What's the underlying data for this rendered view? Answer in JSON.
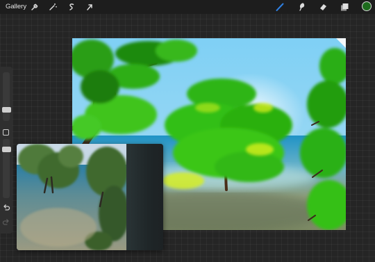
{
  "toolbar": {
    "gallery_label": "Gallery",
    "left_icons": [
      "wrench-icon",
      "magic-wand-icon",
      "selection-icon",
      "transform-arrow-icon"
    ],
    "right_icons": [
      "brush-icon",
      "smudge-icon",
      "eraser-icon",
      "layers-icon"
    ],
    "active_color": "#1d6b1d",
    "active_tool_color": "#2f7fe0"
  },
  "sidebar": {
    "brush_size_level": 0.78,
    "opacity_level": 0.18
  },
  "colors": {
    "sky": "#87cdf0",
    "sea": "#1f93c6",
    "foliage": "#2ecc1a",
    "trunk": "#3b2a1c"
  }
}
